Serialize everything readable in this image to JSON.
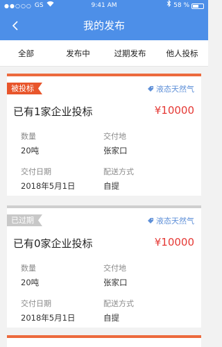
{
  "status_bar": {
    "carrier": "GS",
    "time": "9:41 AM",
    "battery_text": "58 %",
    "battery_level": 0.58
  },
  "nav": {
    "title": "我的发布",
    "back_icon": "chevron-left-icon"
  },
  "tabs": [
    {
      "label": "全部"
    },
    {
      "label": "发布中"
    },
    {
      "label": "过期发布"
    },
    {
      "label": "他人投标"
    }
  ],
  "cards": [
    {
      "badge": "被投标",
      "badge_color": "#e8552b",
      "topbar_color": "#ec6a3d",
      "product": "液态天然气",
      "headline": "已有1家企业投标",
      "price": "¥10000",
      "fields": {
        "qty_label": "数量",
        "qty_value": "20吨",
        "place_label": "交付地",
        "place_value": "张家口",
        "date_label": "交付日期",
        "date_value": "2018年5月1日",
        "ship_label": "配送方式",
        "ship_value": "自提"
      }
    },
    {
      "badge": "已过期",
      "badge_color": "#c8c8c8",
      "topbar_color": "#cfcfcf",
      "product": "液态天然气",
      "headline": "已有0家企业投标",
      "price": "¥10000",
      "fields": {
        "qty_label": "数量",
        "qty_value": "20吨",
        "place_label": "交付地",
        "place_value": "张家口",
        "date_label": "交付日期",
        "date_value": "2018年5月1日",
        "ship_label": "配送方式",
        "ship_value": "自提"
      }
    }
  ],
  "colors": {
    "header_bg": "#4d8fe8",
    "price": "#e53935",
    "product_tag": "#5f90d8"
  }
}
